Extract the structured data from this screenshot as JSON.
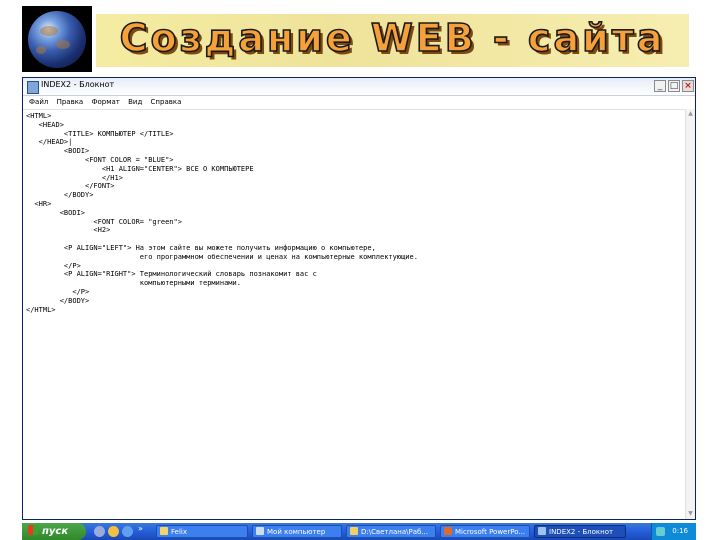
{
  "slide": {
    "banner_title": "Создание WEB - сайта"
  },
  "window": {
    "title": "INDEX2 - Блокнот",
    "buttons": {
      "minimize": "_",
      "maximize": "□",
      "close": "×"
    }
  },
  "menu": [
    "Файл",
    "Правка",
    "Формат",
    "Вид",
    "Справка"
  ],
  "editor": {
    "content": "<HTML>\n   <HEAD>\n         <TITLE> КОМПЬЮТЕР </TITLE>\n   </HEAD>|\n         <BODI>\n              <FONT COLOR = \"BLUE\">\n                  <H1 ALIGN=\"CENTER\"> ВСЕ О КОМПЬЮТЕРЕ\n                  </H1>\n              </FONT>\n         </BODY>\n  <HR>\n        <BODI>\n                <FONT COLOR= \"green\">\n                <H2>\n\n         <P ALIGN=\"LEFT\"> На этом сайте вы можете получить информацию о компьютере,\n                           его программном обеспечении и ценах на компьютерные комплектующие.\n         </P>\n         <P ALIGN=\"RIGHT\"> Терминологический словарь познакомит вас с\n                           компьютерными терминами.\n           </P>\n        </BODY>\n</HTML>"
  },
  "taskbar": {
    "start_label": "пуск",
    "tasks": [
      {
        "label": "Felix",
        "icon": "felix-icon"
      },
      {
        "label": "Мой компьютер",
        "icon": "my-computer-icon"
      },
      {
        "label": "D:\\Светлана\\Раб...",
        "icon": "folder-icon"
      },
      {
        "label": "Microsoft PowerPo...",
        "icon": "powerpoint-icon"
      },
      {
        "label": "INDEX2 - Блокнот",
        "icon": "notepad-icon"
      }
    ],
    "language": "RU",
    "clock": "0:16"
  }
}
